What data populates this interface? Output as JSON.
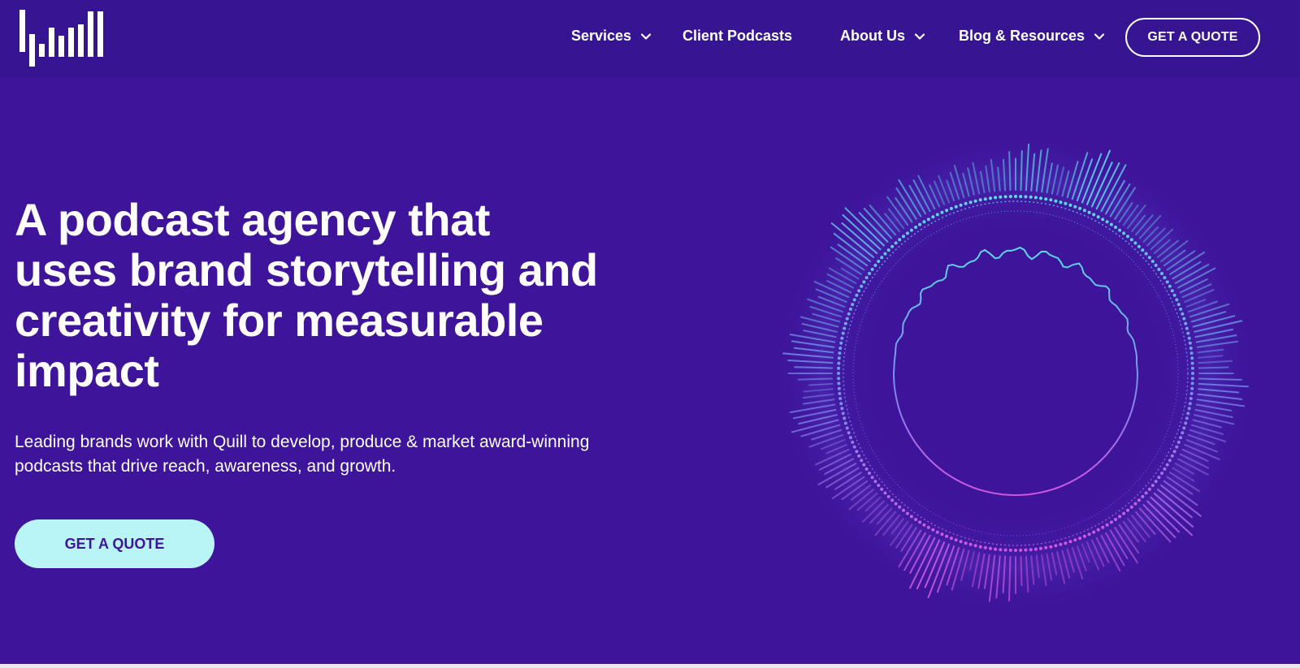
{
  "brand": {
    "logo_icon": "quill-bars-logo",
    "background": "#3d149a",
    "header_background": "#371592",
    "accent": "#b9f5f7",
    "text": "#ffffff"
  },
  "nav": {
    "items": [
      {
        "label": "Services",
        "has_dropdown": true
      },
      {
        "label": "Client Podcasts",
        "has_dropdown": false
      },
      {
        "label": "About Us",
        "has_dropdown": true
      },
      {
        "label": "Blog & Resources",
        "has_dropdown": true
      }
    ],
    "quote_label": "GET A QUOTE"
  },
  "hero": {
    "title_lines": [
      "A podcast agency that",
      "uses brand storytelling and",
      "creativity for measurable",
      "impact"
    ],
    "subtitle_lines": [
      "Leading brands work with Quill to develop, produce & market award-winning",
      "podcasts that drive reach, awareness, and growth."
    ],
    "cta_label": "GET A QUOTE",
    "visual_icon": "circular-sound-wave-graphic"
  }
}
